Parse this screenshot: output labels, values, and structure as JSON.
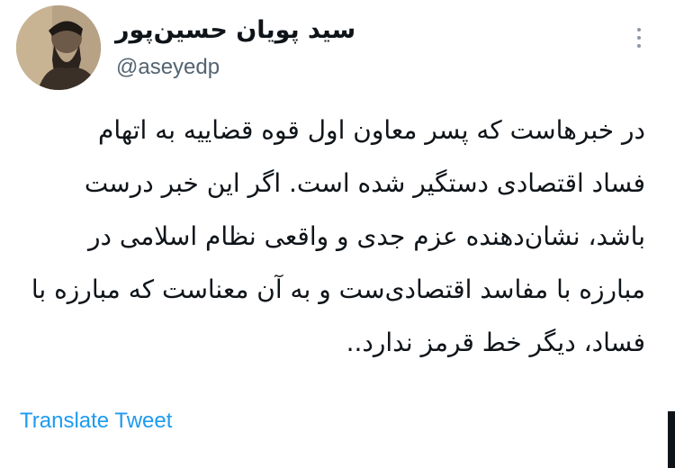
{
  "author": {
    "display_name": "سید پویان حسین‌پور",
    "handle": "@aseyedp",
    "avatar_icon": "profile-photo"
  },
  "tweet": {
    "lines": [
      "در خبرهاست که پسر معاون اول قوه قضاییه به اتهام",
      "فساد اقتصادی دستگیر شده است. اگر این خبر درست",
      "باشد، نشان‌دهنده عزم جدی و واقعی نظام اسلامی در",
      "مبارزه با مفاسد اقتصادی‌ست و به آن معناست که مبارزه با",
      "فساد، دیگر خط قرمز ندارد.."
    ],
    "translate_label": "Translate Tweet"
  },
  "menu_icon": "more-options-icon",
  "colors": {
    "text": "#0f1419",
    "handle": "#536471",
    "link": "#1d9bf0"
  }
}
